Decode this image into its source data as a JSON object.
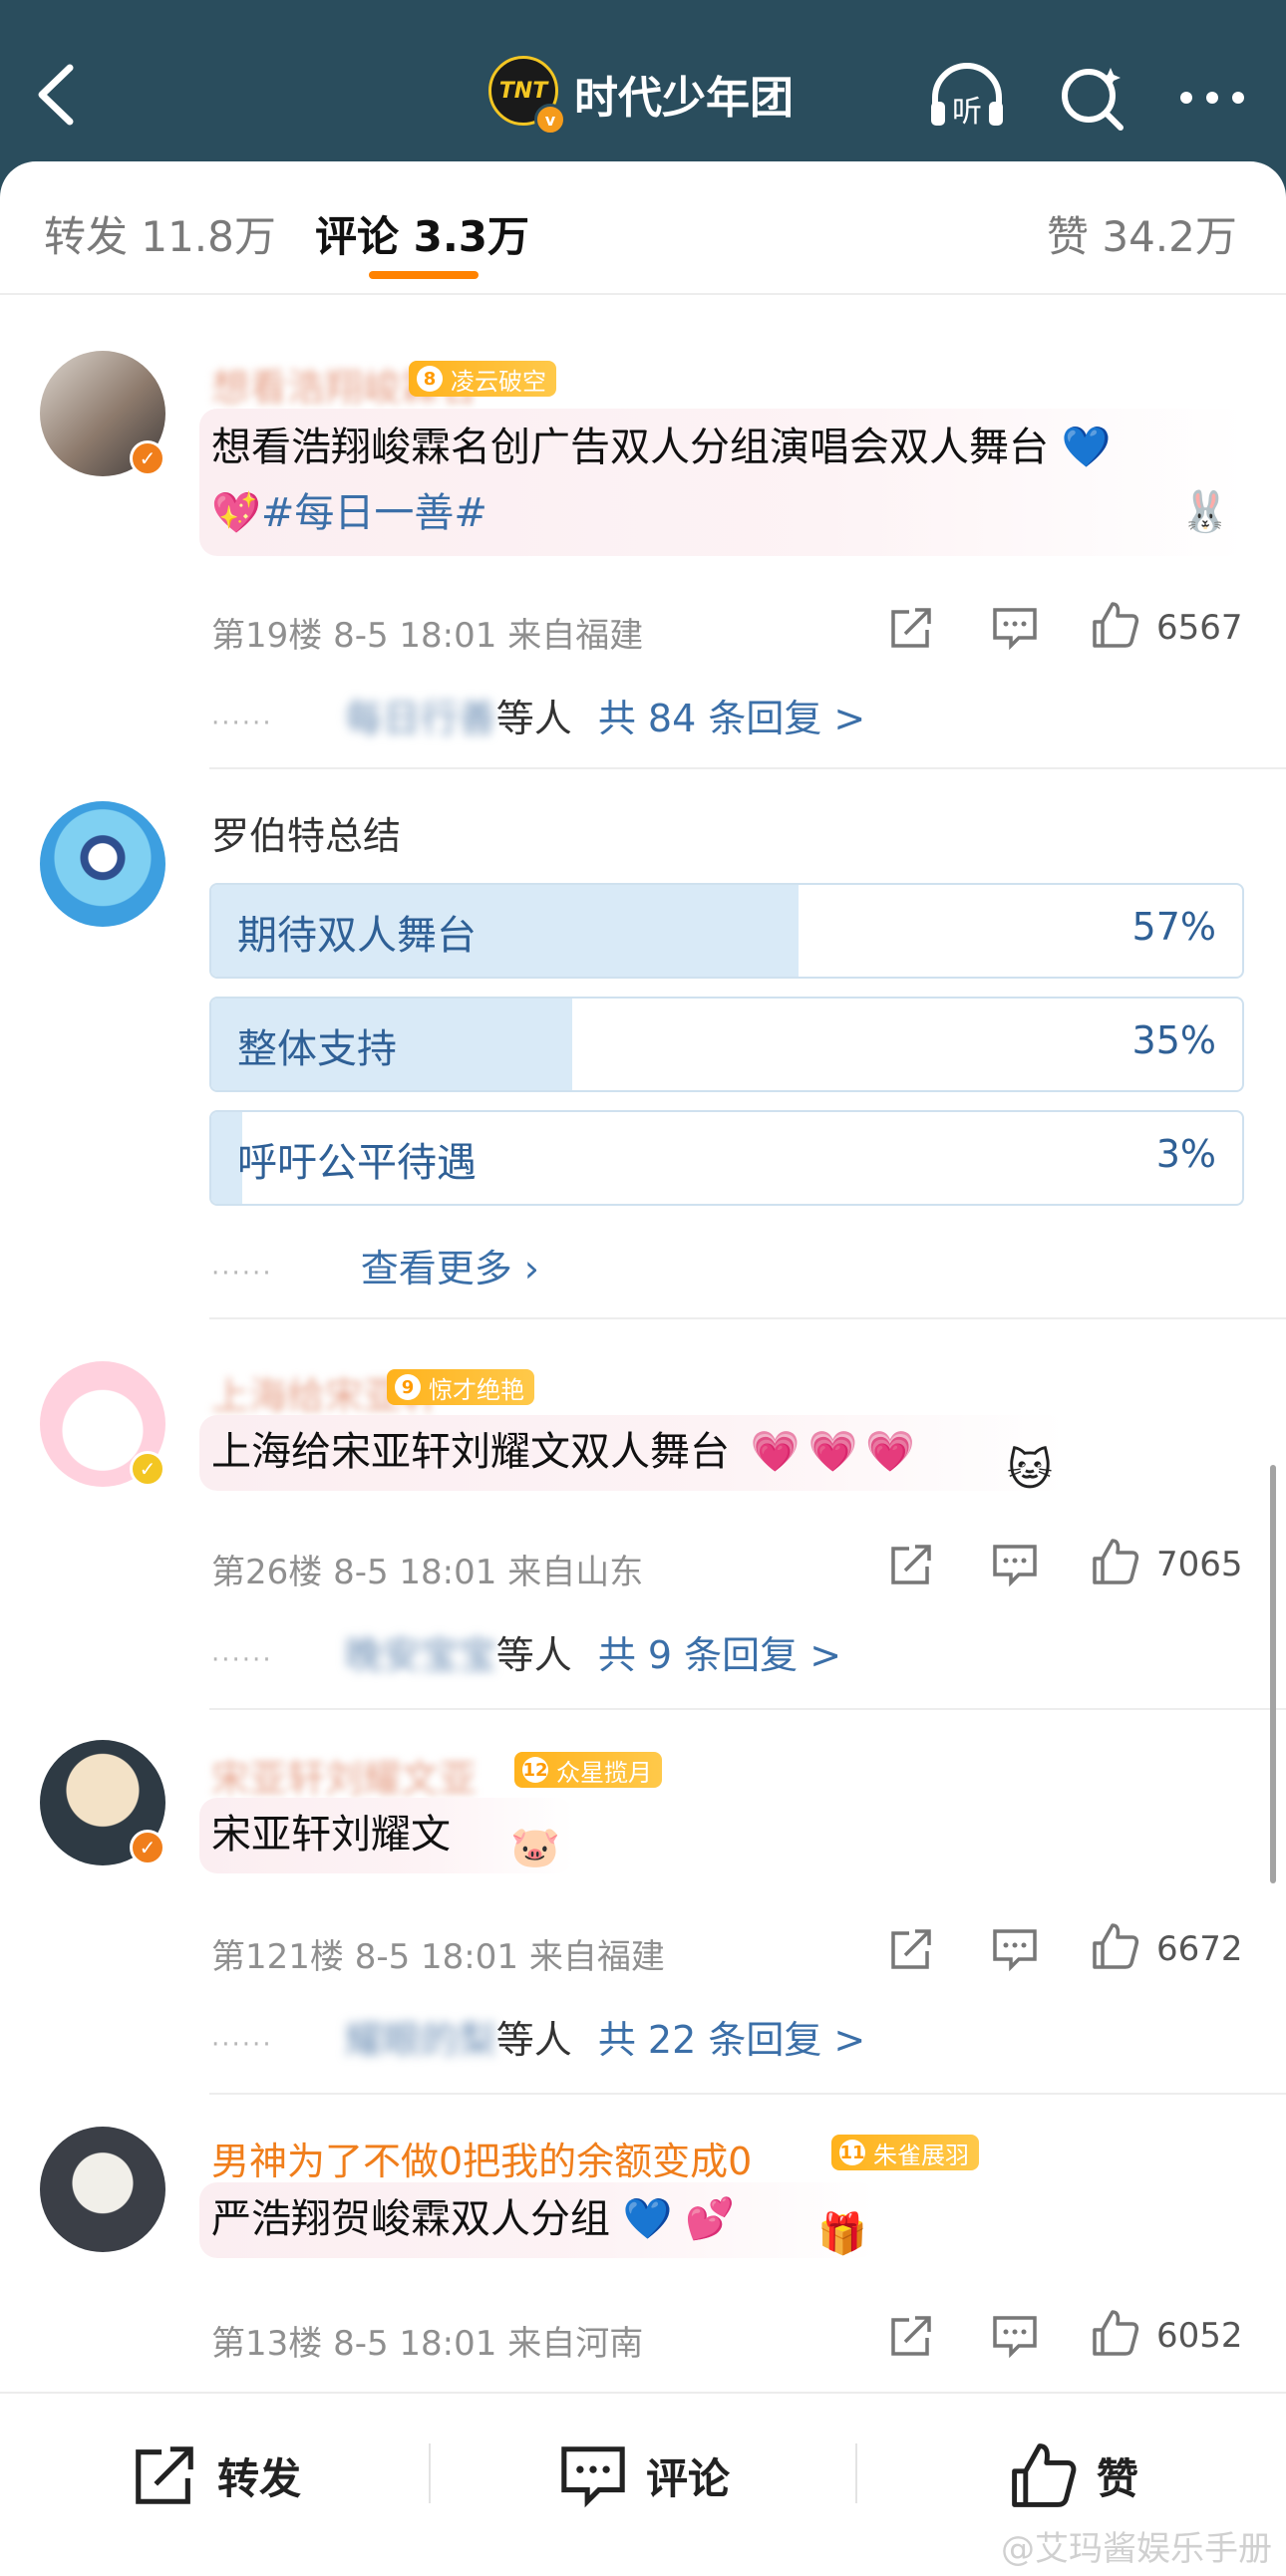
{
  "header": {
    "title": "时代少年团",
    "logo_text": "TNT",
    "logo_badge": "v",
    "icons": [
      "back-icon",
      "listen-icon",
      "search-icon",
      "more-icon"
    ],
    "listen_label": "听"
  },
  "tabs": [
    {
      "label": "转发 11.8万"
    },
    {
      "label": "评论 3.3万"
    },
    {
      "label": "赞 34.2万"
    }
  ],
  "comments": [
    {
      "username": "想看浩翔峻霖名",
      "fan_badge": {
        "level": "8",
        "title": "凌云破空"
      },
      "text_line1": "想看浩翔峻霖名创广告双人分组演唱会双人舞台",
      "text_line2_tag": "#每日一善#",
      "meta": "第19楼  8-5 18:01  来自福建",
      "likes": "6567",
      "replies": {
        "dots": "······",
        "name": "每日行善",
        "who": "等人",
        "more": "共 84 条回复 >"
      }
    },
    {
      "username": "上海给宋亚轩",
      "fan_badge": {
        "level": "9",
        "title": "惊才绝艳"
      },
      "text": "上海给宋亚轩刘耀文双人舞台",
      "meta": "第26楼  8-5 18:01  来自山东",
      "likes": "7065",
      "replies": {
        "dots": "······",
        "name": "晚安宝宝",
        "who": "等人",
        "more": "共 9 条回复 >"
      }
    },
    {
      "username": "宋亚轩刘耀文亚",
      "fan_badge": {
        "level": "12",
        "title": "众星揽月"
      },
      "text": "宋亚轩刘耀文",
      "meta": "第121楼  8-5 18:01  来自福建",
      "likes": "6672",
      "replies": {
        "dots": "······",
        "name": "耀眼的梨",
        "who": "等人",
        "more": "共 22 条回复 >"
      }
    },
    {
      "username": "男神为了不做0把我的余额变成0",
      "fan_badge": {
        "level": "11",
        "title": "朱雀展羽"
      },
      "text": "严浩翔贺峻霖双人分组",
      "meta": "第13楼  8-5 18:01  来自河南",
      "likes": "6052"
    }
  ],
  "poll": {
    "username": "罗伯特总结",
    "options": [
      {
        "label": "期待双人舞台",
        "pct_text": "57%",
        "fraction": 0.57
      },
      {
        "label": "整体支持",
        "pct_text": "35%",
        "fraction": 0.35
      },
      {
        "label": "呼吁公平待遇",
        "pct_text": "3%",
        "fraction": 0.03
      }
    ],
    "more_dots": "······",
    "more_label": "查看更多 ›"
  },
  "bottom_bar": {
    "repost": "转发",
    "comment": "评论",
    "like": "赞"
  },
  "watermark": "@艾玛酱娱乐手册",
  "colors": {
    "header_bg": "#2a4d5d",
    "accent": "#ff8200",
    "link": "#3b6fa8",
    "poll_fill": "#d9eaf7",
    "fan_badge": "#ffb21c"
  }
}
